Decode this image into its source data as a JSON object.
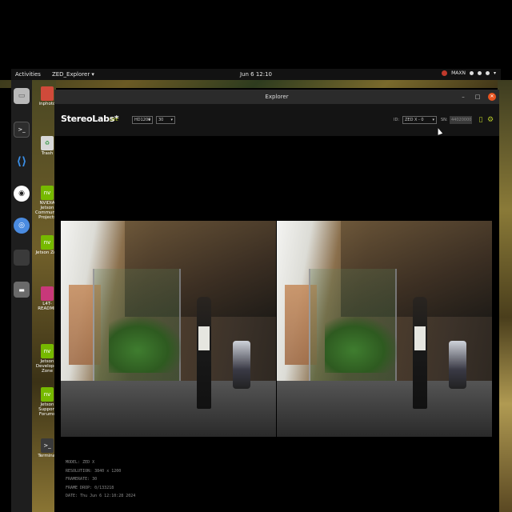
{
  "topbar": {
    "activities": "Activities",
    "app_menu": "ZED_Explorer ▾",
    "clock": "Jun 6  12:10",
    "tray_label": "MAXN"
  },
  "dock": {
    "items": [
      {
        "icon": "files-icon",
        "color": "#9a9a9a"
      },
      {
        "icon": "terminal-icon",
        "color": "#2d2d2d"
      },
      {
        "icon": "vscode-icon",
        "color": "#1e6fd0"
      },
      {
        "icon": "obs-icon",
        "color": "#2b2b2b"
      },
      {
        "icon": "chromium-icon",
        "color": "#3a7bd5"
      },
      {
        "icon": "app-icon",
        "color": "#3a3a3a"
      },
      {
        "icon": "drive-icon",
        "color": "#555555"
      }
    ]
  },
  "desktop": {
    "icons": [
      {
        "label": "inphoto",
        "color": "#d04a3a"
      },
      {
        "label": "Trash",
        "color": "#3a9a4a"
      },
      {
        "label": "NVIDIA Jetson Community Projects",
        "color": "#76b900"
      },
      {
        "label": "Jetson Zoo",
        "color": "#76b900"
      },
      {
        "label": "L4T-README",
        "color": "#c8387a"
      },
      {
        "label": "Jetson Developer Zone",
        "color": "#76b900"
      },
      {
        "label": "Jetson Support Forums",
        "color": "#76b900"
      },
      {
        "label": "Terminal",
        "color": "#3a3a3a"
      }
    ]
  },
  "window": {
    "title": "Explorer",
    "controls": {
      "minimize": "–",
      "maximize": "□",
      "close": "✕"
    }
  },
  "appbar": {
    "logo": "StereoLabs*",
    "live_label": "LIVE",
    "resolution_select": "HD1200",
    "fps_select": "30",
    "serial_label": "SN:",
    "serial_value": "44020000",
    "id_label": "ID:",
    "device_select": "ZED X - 0",
    "record_icon": "record-icon",
    "settings_icon": "settings-icon"
  },
  "metadata": {
    "model_label": "MODEL:",
    "model_value": "ZED X",
    "resolution_label": "RESOLUTION:",
    "resolution_value": "3840 x 1200",
    "framerate_label": "FRAMERATE:",
    "framerate_value": "30",
    "frame_drop_label": "FRAME DROP:",
    "frame_drop_value": "0/133218",
    "date_label": "DATE:",
    "date_value": "Thu Jun 6 12:10:28 2024"
  }
}
